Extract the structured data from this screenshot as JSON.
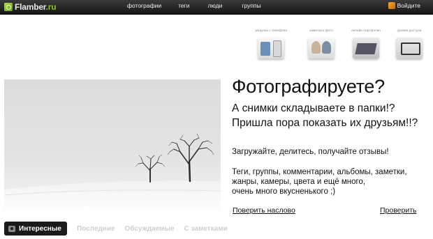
{
  "header": {
    "logo_name": "Flamber",
    "logo_tld": ".ru",
    "nav": [
      "фотографии",
      "теги",
      "люди",
      "группы"
    ],
    "login_label": "Войдите"
  },
  "features": [
    {
      "caption": "загрузка с телефона"
    },
    {
      "caption": "заметки к фото"
    },
    {
      "caption": "онлайн портфолио"
    },
    {
      "caption": "уровни доступа"
    }
  ],
  "hero": {
    "headline": "Фотографируете?",
    "line2": "А снимки складываете в папки!?",
    "line3": "Пришла пора показать их друзьям!!?",
    "intro": "Загружайте, делитесь, получайте отзывы!",
    "details": [
      "Теги, группы, комментарии, альбомы, заметки,",
      "жанры, камеры, цвета и ещё много,",
      "очень много вкусненького ;)"
    ],
    "trust_link": "Поверить наслово",
    "check_link": "Проверить"
  },
  "tabs": {
    "active": "Интересные",
    "others": [
      "Последние",
      "Обсуждаемые",
      "С заметками"
    ]
  }
}
